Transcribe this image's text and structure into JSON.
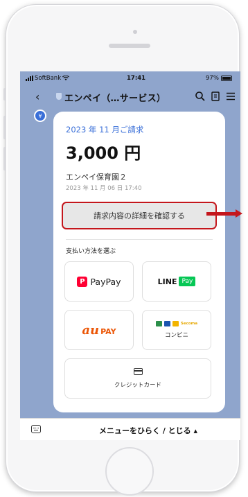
{
  "status_bar": {
    "carrier": "SoftBank",
    "time": "17:41",
    "battery": "97%"
  },
  "nav": {
    "title": "エンペイ（…サービス）",
    "back_icon": "chevron-left-icon",
    "icons": [
      "search-icon",
      "notes-icon",
      "menu-icon"
    ]
  },
  "message": {
    "avatar_icon": "yen-icon",
    "heading": "2023 年 11 月ご請求",
    "amount": "3,000 円",
    "payee": "エンペイ保育園２",
    "date": "2023 年 11 月 06 日 17:40",
    "detail_button": "請求内容の詳細を確認する",
    "pay_heading": "支払い方法を選ぶ",
    "methods": {
      "paypay": "PayPay",
      "line": "LINE",
      "line_pay": "Pay",
      "au": "au",
      "au_pay": "PAY",
      "secoma": "Secoma",
      "convenience": "コンビニ",
      "credit": "クレジットカード"
    }
  },
  "menu_bar": {
    "label": "メニューをひらく / とじる ▴"
  },
  "colors": {
    "accent": "#3a6fd8",
    "highlight": "#c4161c",
    "chat_bg": "#8fa5cc",
    "paypay": "#ff0033",
    "line_pay": "#06c755",
    "au_pay": "#eb5505"
  }
}
